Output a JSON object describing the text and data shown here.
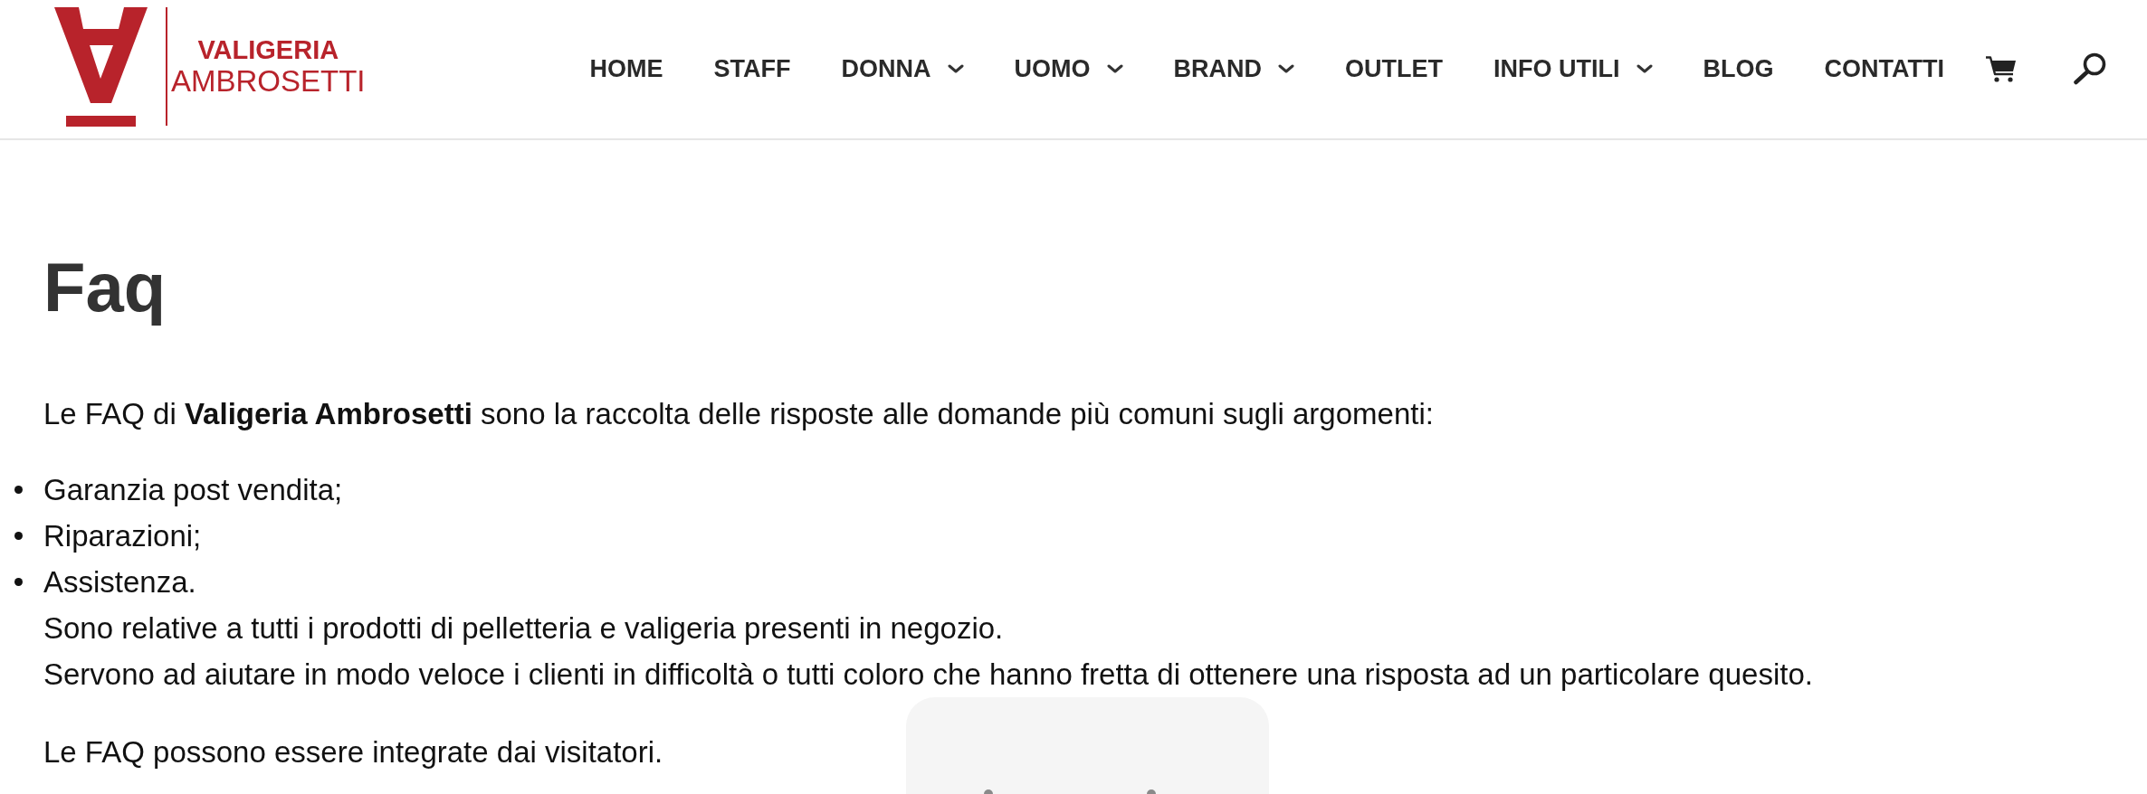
{
  "header": {
    "logo": {
      "line_1": "VALIGERIA",
      "line_2": "AMBROSETTI"
    },
    "nav": [
      {
        "label": "HOME",
        "submenu": false
      },
      {
        "label": "STAFF",
        "submenu": false
      },
      {
        "label": "DONNA",
        "submenu": true
      },
      {
        "label": "UOMO",
        "submenu": true
      },
      {
        "label": "BRAND",
        "submenu": true
      },
      {
        "label": "OUTLET",
        "submenu": false
      },
      {
        "label": "INFO UTILI",
        "submenu": true
      },
      {
        "label": "BLOG",
        "submenu": false
      },
      {
        "label": "CONTATTI",
        "submenu": false
      }
    ]
  },
  "content": {
    "title": "Faq",
    "intro": "Le FAQ di **Valigeria Ambrosetti** sono la raccolta delle risposte alle domande più comuni sugli argomenti:",
    "topics": [
      "Garanzia post vendita;",
      "Riparazioni;",
      "Assistenza."
    ],
    "notes": [
      "Sono relative a tutti i prodotti di pelletteria e valigeria presenti in negozio.",
      "Servono ad aiutare in modo veloce i clienti in difficoltà o tutti coloro che hanno fretta di ottenere una risposta ad un particolare quesito."
    ],
    "closing": "Le FAQ possono essere integrate dai visitatori."
  }
}
